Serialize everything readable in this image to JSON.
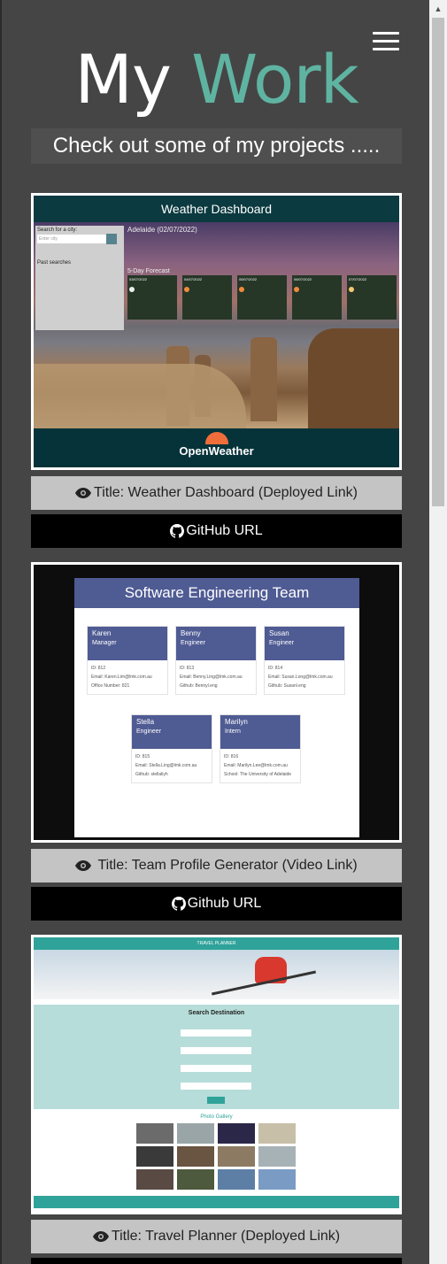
{
  "header": {
    "title_part1": "My",
    "title_part2": "Work",
    "subtitle": "Check out some of my projects ....."
  },
  "projects": [
    {
      "caption": "Title: Weather Dashboard (Deployed Link)",
      "repo_label": "GitHub URL",
      "screenshot": {
        "heading": "Weather Dashboard",
        "search_label": "Search for a city:",
        "search_placeholder": "Enter city",
        "past_searches": "Past searches",
        "city": "Adelaide (02/07/2022)",
        "forecast_label": "5-Day Forecast",
        "days": [
          "03/07/2022",
          "04/07/2022",
          "05/07/2022",
          "06/07/2022",
          "07/07/2022"
        ],
        "brand": "OpenWeather"
      }
    },
    {
      "caption": "Title: Team Profile Generator (Video Link)",
      "repo_label": "Github URL",
      "screenshot": {
        "heading": "Software Engineering Team",
        "members": [
          {
            "name": "Karen",
            "role": "Manager",
            "id": "ID: 812",
            "email": "Email: Karen.Lim@lmk.com.au",
            "extra": "Office Number: 821"
          },
          {
            "name": "Benny",
            "role": "Engineer",
            "id": "ID: 813",
            "email": "Email: Benny.Ling@lmk.com.au",
            "extra": "Github: Bennyl.eng"
          },
          {
            "name": "Susan",
            "role": "Engineer",
            "id": "ID: 814",
            "email": "Email: Susan.Long@lmk.com.au",
            "extra": "Github: Susanl.eng"
          },
          {
            "name": "Stella",
            "role": "Engineer",
            "id": "ID: 815",
            "email": "Email: Stella.Ling@lmk.com.au",
            "extra": "Github: stellaliyh"
          },
          {
            "name": "Marilyn",
            "role": "Intern",
            "id": "ID: 816",
            "email": "Email: Marilyn.Lee@lmk.com.au",
            "extra": "School: The University of Adelaide"
          }
        ]
      }
    },
    {
      "caption": "Title: Travel Planner (Deployed Link)",
      "screenshot": {
        "heading": "TRAVEL PLANNER",
        "search_heading": "Search Destination",
        "gallery_heading": "Photo Gallery"
      }
    }
  ],
  "icons": {
    "eye": "eye-icon",
    "github": "github-icon",
    "menu": "hamburger-menu-icon"
  },
  "colors": {
    "accent": "#5fb3a1",
    "background": "#454545",
    "caption_bg": "#c4c4c4",
    "link_bg": "#000000"
  }
}
